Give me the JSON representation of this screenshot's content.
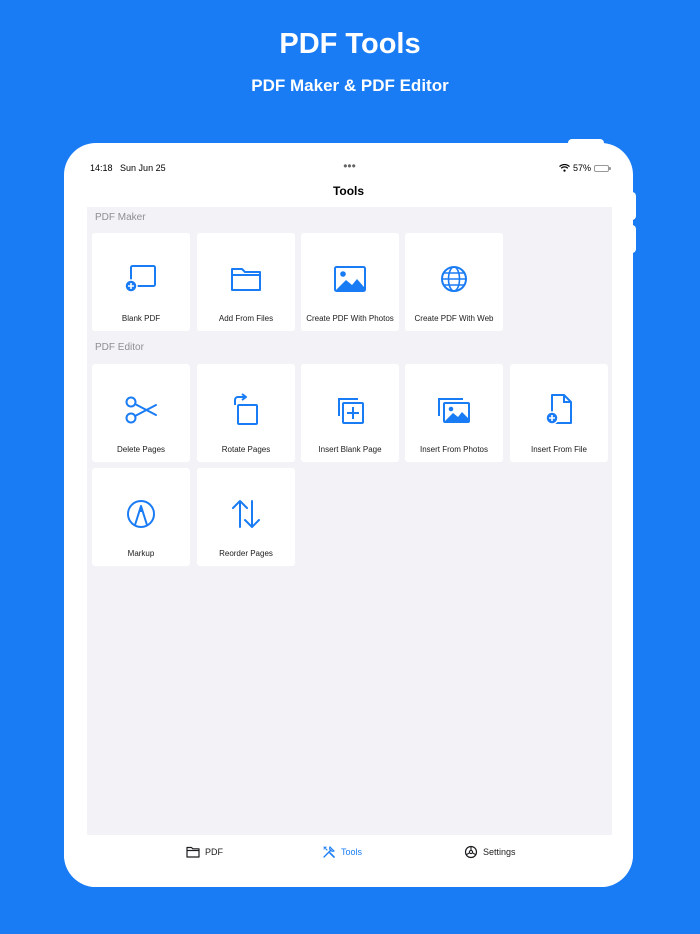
{
  "marketing": {
    "title": "PDF Tools",
    "subtitle": "PDF Maker & PDF Editor"
  },
  "status_bar": {
    "time": "14:18",
    "date": "Sun Jun 25",
    "dots": "•••",
    "battery_percent": "57%",
    "battery_level": 0.57
  },
  "nav": {
    "title": "Tools"
  },
  "sections": {
    "maker": {
      "label": "PDF Maker",
      "items": [
        {
          "label": "Blank PDF",
          "icon": "blank-pdf-icon"
        },
        {
          "label": "Add From Files",
          "icon": "folder-icon"
        },
        {
          "label": "Create PDF With Photos",
          "icon": "photo-icon"
        },
        {
          "label": "Create PDF With Web",
          "icon": "globe-icon"
        }
      ]
    },
    "editor": {
      "label": "PDF Editor",
      "items": [
        {
          "label": "Delete Pages",
          "icon": "scissors-icon"
        },
        {
          "label": "Rotate Pages",
          "icon": "rotate-icon"
        },
        {
          "label": "Insert Blank Page",
          "icon": "insert-blank-page-icon"
        },
        {
          "label": "Insert From Photos",
          "icon": "photos-stack-icon"
        },
        {
          "label": "Insert From File",
          "icon": "file-add-icon"
        },
        {
          "label": "Markup",
          "icon": "markup-pen-icon"
        },
        {
          "label": "Reorder Pages",
          "icon": "reorder-arrows-icon"
        }
      ]
    }
  },
  "tabbar": {
    "tabs": [
      {
        "label": "PDF",
        "icon": "folder-icon"
      },
      {
        "label": "Tools",
        "icon": "tools-icon",
        "active": true
      },
      {
        "label": "Settings",
        "icon": "settings-icon"
      }
    ]
  },
  "colors": {
    "accent": "#1a7cf5",
    "background": "#1a7cf5",
    "content_bg": "#f2f2f7",
    "battery": "#f5c518"
  }
}
